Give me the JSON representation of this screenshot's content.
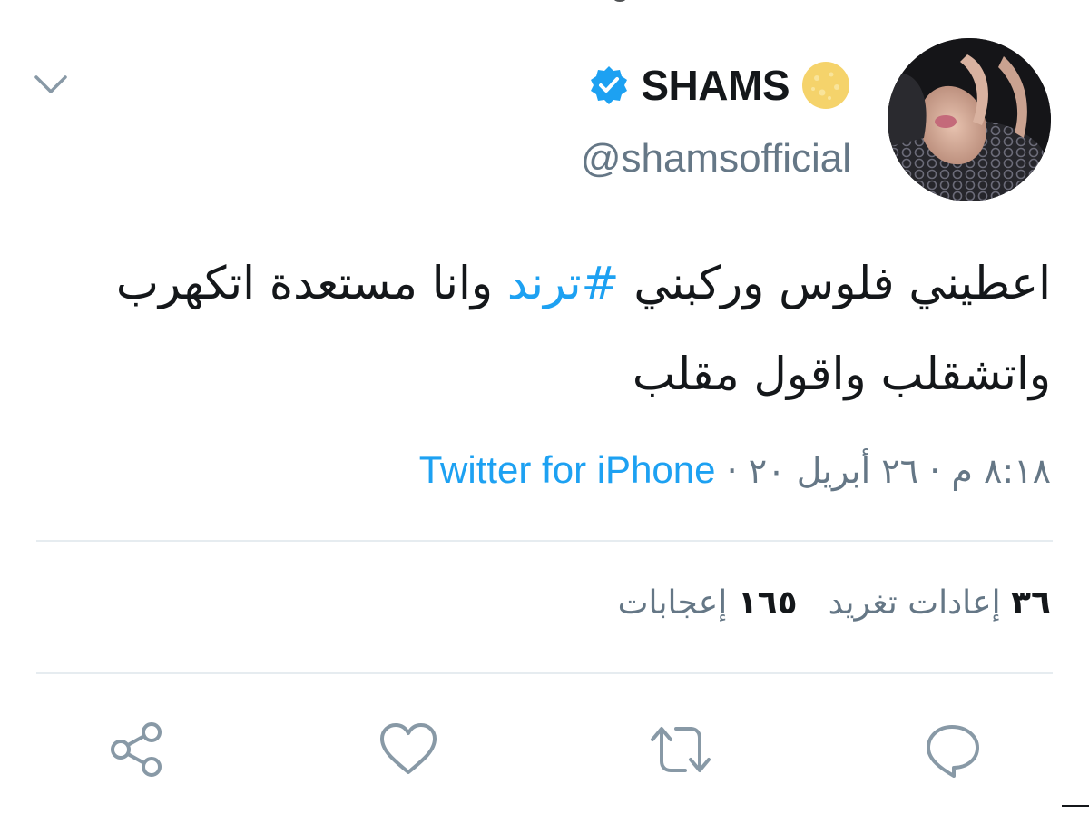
{
  "tweet": {
    "display_name": "SHAMS",
    "handle": "@shamsofficial",
    "text_part1": "اعطيني فلوس وركبني ",
    "hashtag": "#ترند",
    "text_part2": " وانا مستعدة اتكهرب واتشقلب واقول مقلب",
    "time": "٨:١٨ م",
    "date": "٢٦ أبريل ٢٠",
    "separator": "·",
    "source": "Twitter for iPhone"
  },
  "stats": {
    "retweets_count": "٣٦",
    "retweets_label": "إعادات تغريد",
    "likes_count": "١٦٥",
    "likes_label": "إعجابات"
  },
  "icons": {
    "verified": "verified-badge-icon",
    "name_emoji": "sun-emoji-icon",
    "menu": "chevron-down-icon",
    "reply": "reply-icon",
    "retweet": "retweet-icon",
    "like": "heart-icon",
    "share": "share-icon"
  },
  "colors": {
    "accent": "#1da1f2",
    "secondary_text": "#657786",
    "primary_text": "#14171a",
    "divider": "#e6ecf0",
    "emoji": "#f5d36b"
  }
}
